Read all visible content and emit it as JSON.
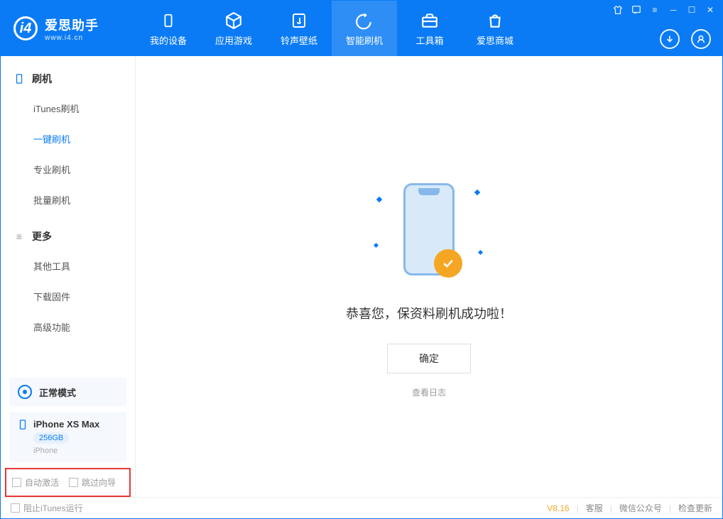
{
  "app": {
    "name": "爱思助手",
    "url": "www.i4.cn"
  },
  "nav": {
    "tabs": [
      {
        "label": "我的设备",
        "icon": "device"
      },
      {
        "label": "应用游戏",
        "icon": "cube"
      },
      {
        "label": "铃声壁纸",
        "icon": "music"
      },
      {
        "label": "智能刷机",
        "icon": "refresh",
        "active": true
      },
      {
        "label": "工具箱",
        "icon": "toolbox"
      },
      {
        "label": "爱思商城",
        "icon": "shop"
      }
    ]
  },
  "sidebar": {
    "section1": {
      "title": "刷机",
      "items": [
        {
          "label": "iTunes刷机"
        },
        {
          "label": "一键刷机",
          "active": true
        },
        {
          "label": "专业刷机"
        },
        {
          "label": "批量刷机"
        }
      ]
    },
    "section2": {
      "title": "更多",
      "items": [
        {
          "label": "其他工具"
        },
        {
          "label": "下载固件"
        },
        {
          "label": "高级功能"
        }
      ]
    },
    "mode": "正常模式",
    "device": {
      "name": "iPhone XS Max",
      "storage": "256GB",
      "type": "iPhone"
    },
    "options": {
      "auto_activate": "自动激活",
      "skip_guide": "跳过向导"
    }
  },
  "main": {
    "success_message": "恭喜您，保资料刷机成功啦！",
    "confirm_label": "确定",
    "view_log_label": "查看日志"
  },
  "footer": {
    "block_itunes": "阻止iTunes运行",
    "version": "V8.16",
    "links": [
      "客服",
      "微信公众号",
      "检查更新"
    ]
  }
}
